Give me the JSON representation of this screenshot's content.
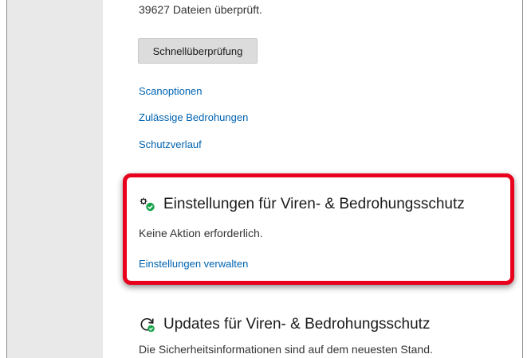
{
  "scan": {
    "files_checked": "39627 Dateien überprüft.",
    "quick_scan_button": "Schnellüberprüfung",
    "links": {
      "scan_options": "Scanoptionen",
      "allowed_threats": "Zulässige Bedrohungen",
      "protection_history": "Schutzverlauf"
    }
  },
  "settings_section": {
    "title": "Einstellungen für Viren- & Bedrohungsschutz",
    "status": "Keine Aktion erforderlich.",
    "manage_link": "Einstellungen verwalten",
    "icon": "gear-check-icon"
  },
  "updates_section": {
    "title": "Updates für Viren- & Bedrohungsschutz",
    "status": "Die Sicherheitsinformationen sind auf dem neuesten Stand.",
    "icon": "refresh-check-icon"
  },
  "colors": {
    "link": "#0063b1",
    "highlight_border": "#e8001c",
    "status_ok": "#16a34a",
    "nav_background": "#e9e9e9"
  }
}
